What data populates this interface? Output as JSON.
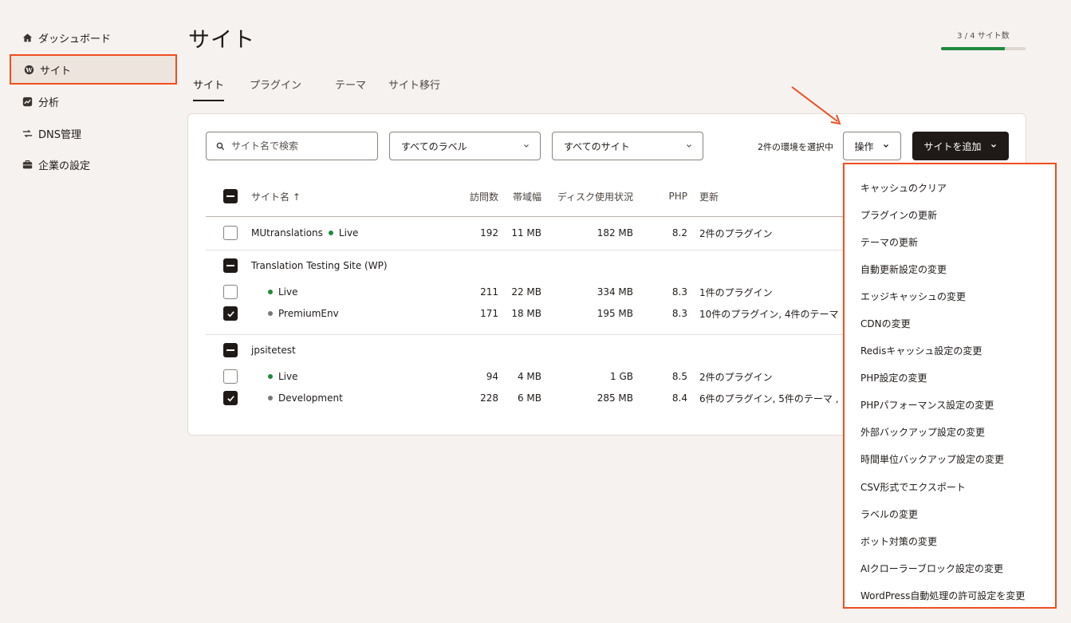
{
  "sidebar": {
    "items": [
      {
        "label": "ダッシュボード",
        "icon": "home-icon"
      },
      {
        "label": "サイト",
        "icon": "wordpress-icon",
        "active": true
      },
      {
        "label": "分析",
        "icon": "analytics-icon"
      },
      {
        "label": "DNS管理",
        "icon": "dns-icon"
      },
      {
        "label": "企業の設定",
        "icon": "briefcase-icon"
      }
    ]
  },
  "header": {
    "title": "サイト",
    "site_count": "3 / 4 サイト数",
    "site_count_fraction": 0.75
  },
  "tabs": [
    {
      "label": "サイト",
      "active": true
    },
    {
      "label": "プラグイン"
    },
    {
      "label": "テーマ"
    },
    {
      "label": "サイト移行"
    }
  ],
  "toolbar": {
    "search_placeholder": "サイト名で検索",
    "label_filter": "すべてのラベル",
    "site_filter": "すべてのサイト",
    "selection_text": "2件の環境を選択中",
    "actions_label": "操作",
    "add_site_label": "サイトを追加"
  },
  "table": {
    "headers": {
      "name": "サイト名 ↑",
      "visits": "訪問数",
      "bandwidth": "帯域幅",
      "disk": "ディスク使用状況",
      "php": "PHP",
      "updates": "更新"
    },
    "rows": [
      {
        "name": "MUtranslations",
        "env": "Live",
        "visits": "192",
        "bandwidth": "11 MB",
        "disk": "182 MB",
        "php": "8.2",
        "updates": "2件のプラグイン"
      },
      {
        "group": "Translation Testing Site (WP)"
      },
      {
        "env": "Live",
        "visits": "211",
        "bandwidth": "22 MB",
        "disk": "334 MB",
        "php": "8.3",
        "updates": "1件のプラグイン"
      },
      {
        "env": "PremiumEnv",
        "visits": "171",
        "bandwidth": "18 MB",
        "disk": "195 MB",
        "php": "8.3",
        "updates": "10件のプラグイン, 4件のテーマ"
      },
      {
        "group": "jpsitetest"
      },
      {
        "env": "Live",
        "visits": "94",
        "bandwidth": "4 MB",
        "disk": "1 GB",
        "php": "8.5",
        "updates": "2件のプラグイン"
      },
      {
        "env": "Development",
        "visits": "228",
        "bandwidth": "6 MB",
        "disk": "285 MB",
        "php": "8.4",
        "updates": "6件のプラグイン, 5件のテーマ ,"
      }
    ]
  },
  "actions_menu": [
    "キャッシュのクリア",
    "プラグインの更新",
    "テーマの更新",
    "自動更新設定の変更",
    "エッジキャッシュの変更",
    "CDNの変更",
    "Redisキャッシュ設定の変更",
    "PHP設定の変更",
    "PHPパフォーマンス設定の変更",
    "外部バックアップ設定の変更",
    "時間単位バックアップ設定の変更",
    "CSV形式でエクスポート",
    "ラベルの変更",
    "ボット対策の変更",
    "AIクローラーブロック設定の変更",
    "WordPress自動処理の許可設定を変更"
  ],
  "colors": {
    "accent": "#f04e1e",
    "live": "#1e8a3d",
    "inactive": "#777777",
    "background": "#f6f2ef"
  }
}
